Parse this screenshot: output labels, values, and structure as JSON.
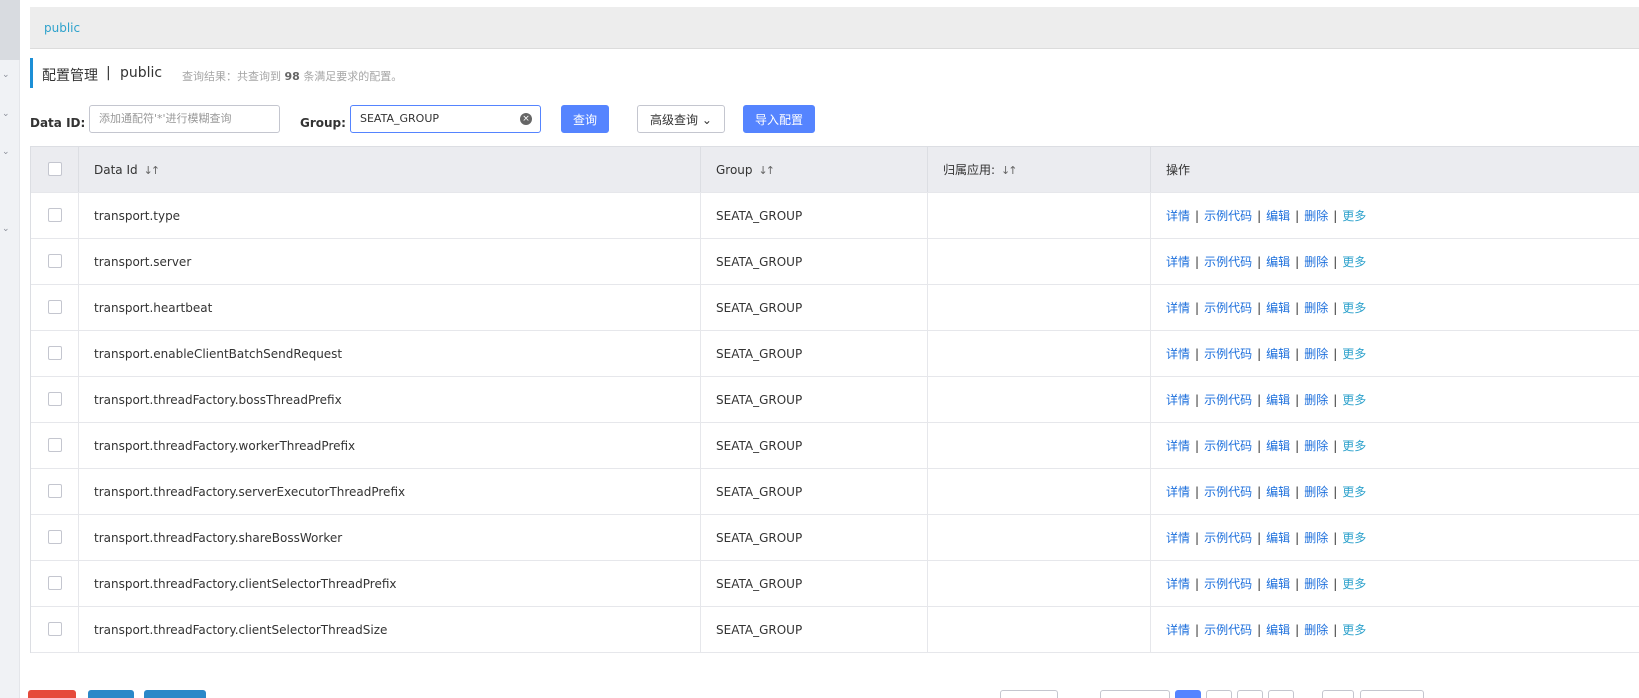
{
  "namespace_bar": {
    "link": "public"
  },
  "page_header": {
    "title": "配置管理",
    "separator": "|",
    "namespace": "public",
    "summary_prefix": "查询结果：共查询到",
    "summary_count": "98",
    "summary_suffix": "条满足要求的配置。"
  },
  "filter": {
    "data_id_label": "Data ID:",
    "data_id_placeholder": "添加通配符'*'进行模糊查询",
    "group_label": "Group:",
    "group_value": "SEATA_GROUP",
    "search_button": "查询",
    "advanced_button": "高级查询",
    "import_button": "导入配置"
  },
  "table": {
    "headers": {
      "data_id": "Data Id",
      "group": "Group",
      "app": "归属应用:",
      "ops": "操作"
    },
    "ops_labels": {
      "detail": "详情",
      "sample": "示例代码",
      "edit": "编辑",
      "delete": "删除",
      "more": "更多"
    },
    "rows": [
      {
        "data_id": "transport.type",
        "group": "SEATA_GROUP",
        "app": ""
      },
      {
        "data_id": "transport.server",
        "group": "SEATA_GROUP",
        "app": ""
      },
      {
        "data_id": "transport.heartbeat",
        "group": "SEATA_GROUP",
        "app": ""
      },
      {
        "data_id": "transport.enableClientBatchSendRequest",
        "group": "SEATA_GROUP",
        "app": ""
      },
      {
        "data_id": "transport.threadFactory.bossThreadPrefix",
        "group": "SEATA_GROUP",
        "app": ""
      },
      {
        "data_id": "transport.threadFactory.workerThreadPrefix",
        "group": "SEATA_GROUP",
        "app": ""
      },
      {
        "data_id": "transport.threadFactory.serverExecutorThreadPrefix",
        "group": "SEATA_GROUP",
        "app": ""
      },
      {
        "data_id": "transport.threadFactory.shareBossWorker",
        "group": "SEATA_GROUP",
        "app": ""
      },
      {
        "data_id": "transport.threadFactory.clientSelectorThreadPrefix",
        "group": "SEATA_GROUP",
        "app": ""
      },
      {
        "data_id": "transport.threadFactory.clientSelectorThreadSize",
        "group": "SEATA_GROUP",
        "app": ""
      }
    ]
  },
  "colors": {
    "primary": "#5584ff",
    "link": "#1c6fdc",
    "accent": "#1c8fd6"
  }
}
